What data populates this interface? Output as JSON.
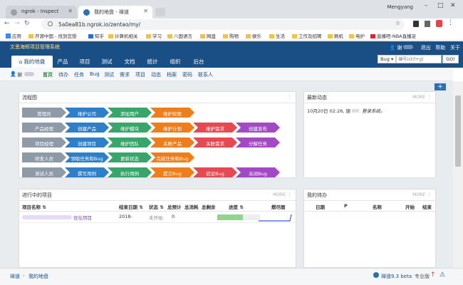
{
  "browser": {
    "tabs": [
      {
        "title": "ngrok - Inspect"
      },
      {
        "title": "我的地盘 - 禅道"
      }
    ],
    "profile": "Mengyang",
    "url": "5a0ea81b.ngrok.io/zentao/my/",
    "bookmarks": [
      "应用",
      "开源中国 - 找到您想",
      "知乎",
      "计算机相关",
      "学习",
      "八国语言",
      "网盘",
      "购物",
      "娱乐",
      "生活",
      "工作及招聘",
      "刷机",
      "电护",
      "直播吧-NBA直播足"
    ]
  },
  "app": {
    "system_title": "文思海辉项目管理系统",
    "nav": [
      "我的地盘",
      "产品",
      "项目",
      "测试",
      "文档",
      "统计",
      "组织",
      "后台"
    ],
    "user": "谢",
    "user_menu": [
      "退出",
      "帮助",
      "关于"
    ],
    "search_type": "Bug",
    "search_placeholder": "编号(ctrl+g)",
    "go_label": "GO!"
  },
  "subnav": {
    "user": "谢",
    "items": [
      "首页",
      "待办",
      "任务",
      "Bug",
      "测试",
      "需求",
      "项目",
      "动态",
      "档案",
      "密码",
      "联系人"
    ]
  },
  "flow": {
    "title": "流程图",
    "rows": [
      {
        "role": "管理员",
        "steps": [
          "维护公司",
          "添加用户",
          "维护权限"
        ]
      },
      {
        "role": "产品经理",
        "steps": [
          "创建产品",
          "维护模块",
          "维护计划",
          "维护需求",
          "创建发布"
        ]
      },
      {
        "role": "项目经理",
        "steps": [
          "创建项目",
          "维护团队",
          "关联产品",
          "关联需求",
          "分解任务"
        ]
      },
      {
        "role": "研发人员",
        "steps": [
          "领取任务和Bug",
          "更新状态",
          "完成任务和Bug"
        ]
      },
      {
        "role": "测试人员",
        "steps": [
          "撰写用例",
          "执行用例",
          "提交Bug",
          "验证Bug",
          "关闭Bug"
        ]
      }
    ]
  },
  "dynamics": {
    "title": "最新动态",
    "more": "MORE",
    "entries": [
      {
        "time": "10月20日 02:26,",
        "user": "谢",
        "text": "登录系统。"
      }
    ]
  },
  "projects": {
    "title": "进行中的项目",
    "more": "MORE",
    "columns": [
      "项目名称",
      "结束日期",
      "状态",
      "总预计",
      "总消耗",
      "总剩余",
      "进度",
      "燃尽图"
    ],
    "rows": [
      {
        "name": "优化项目",
        "end": "2018-",
        "status": "未开始",
        "estimate": "0",
        "consumed": "",
        "left": "",
        "progress": 0.6
      }
    ]
  },
  "todo": {
    "title": "我的待办",
    "more": "MORE",
    "columns": [
      "日期",
      "P",
      "名称",
      "开始",
      "结束"
    ]
  },
  "footer": {
    "breadcrumb": [
      "禅道",
      "我的地盘"
    ],
    "version": "禅道9.3 beta",
    "edition": "专业版"
  },
  "colors": {
    "gray": "#8e9aa7",
    "blue": "#2e7fc7",
    "green": "#3aa56a",
    "orange": "#ee7d1b",
    "red": "#e54a53",
    "purple": "#a24ac2",
    "nav_bg": "#1a4f85"
  }
}
